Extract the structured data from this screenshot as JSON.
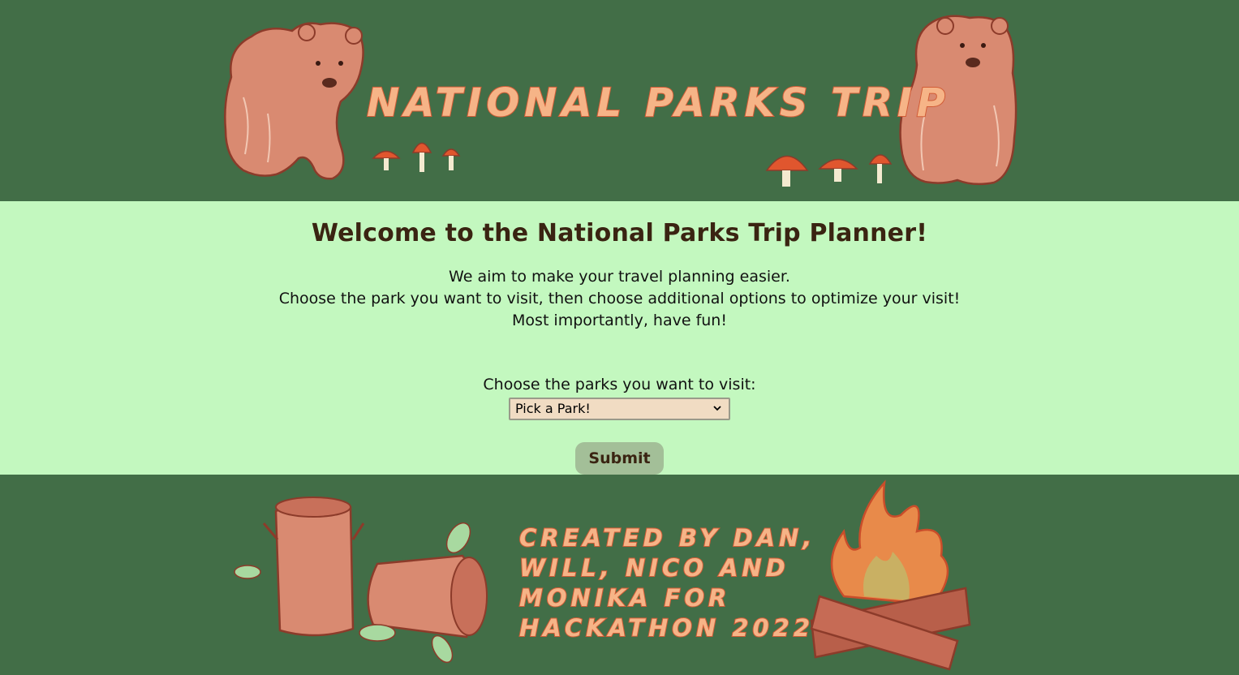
{
  "header": {
    "banner_title": "NATIONAL PARKS TRIP"
  },
  "main": {
    "heading": "Welcome to the National Parks Trip Planner!",
    "intro_lines": [
      "We aim to make your travel planning easier.",
      "Choose the park you want to visit, then choose additional options to optimize your visit!",
      "Most importantly, have fun!"
    ],
    "park_select": {
      "label": "Choose the parks you want to visit:",
      "selected": "Pick a Park!"
    },
    "submit_label": "Submit"
  },
  "footer": {
    "credit_lines": [
      "CREATED BY DAN,",
      "WILL, NICO AND",
      "MONIKA FOR",
      "HACKATHON 2022"
    ]
  },
  "colors": {
    "header_bg": "#426e47",
    "main_bg": "#c3f8bf",
    "heading_color": "#3a2412",
    "select_bg": "#f1dcc3",
    "button_bg": "#a3bf98",
    "illustration_fill": "#d98a71",
    "illustration_stroke": "#8c3b2a"
  },
  "icons": {
    "select_arrow": "chevron-down-icon"
  }
}
